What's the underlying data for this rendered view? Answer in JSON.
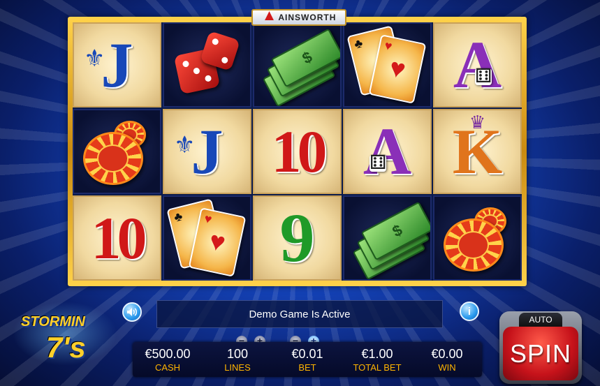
{
  "game": {
    "provider_logo": "AINSWORTH",
    "brand_line1": "STORMIN",
    "brand_line2": "7's"
  },
  "reels": [
    [
      "J",
      "dice",
      "cash",
      "cards",
      "A"
    ],
    [
      "chips",
      "J",
      "10",
      "A",
      "K"
    ],
    [
      "10",
      "cards",
      "9",
      "cash",
      "chips"
    ]
  ],
  "message": "Demo Game Is Active",
  "stats": {
    "cash": {
      "value": "€500.00",
      "label": "CASH"
    },
    "lines": {
      "value": "100",
      "label": "LINES"
    },
    "bet": {
      "value": "€0.01",
      "label": "BET"
    },
    "total_bet": {
      "value": "€1.00",
      "label": "TOTAL BET"
    },
    "win": {
      "value": "€0.00",
      "label": "WIN"
    }
  },
  "controls": {
    "minus": "−",
    "plus": "+",
    "info": "i",
    "auto_label": "AUTO",
    "spin_label": "SPIN"
  },
  "colors": {
    "frame_gold": "#ffd24a",
    "label_orange": "#ffb400",
    "spin_red": "#c6121a"
  }
}
